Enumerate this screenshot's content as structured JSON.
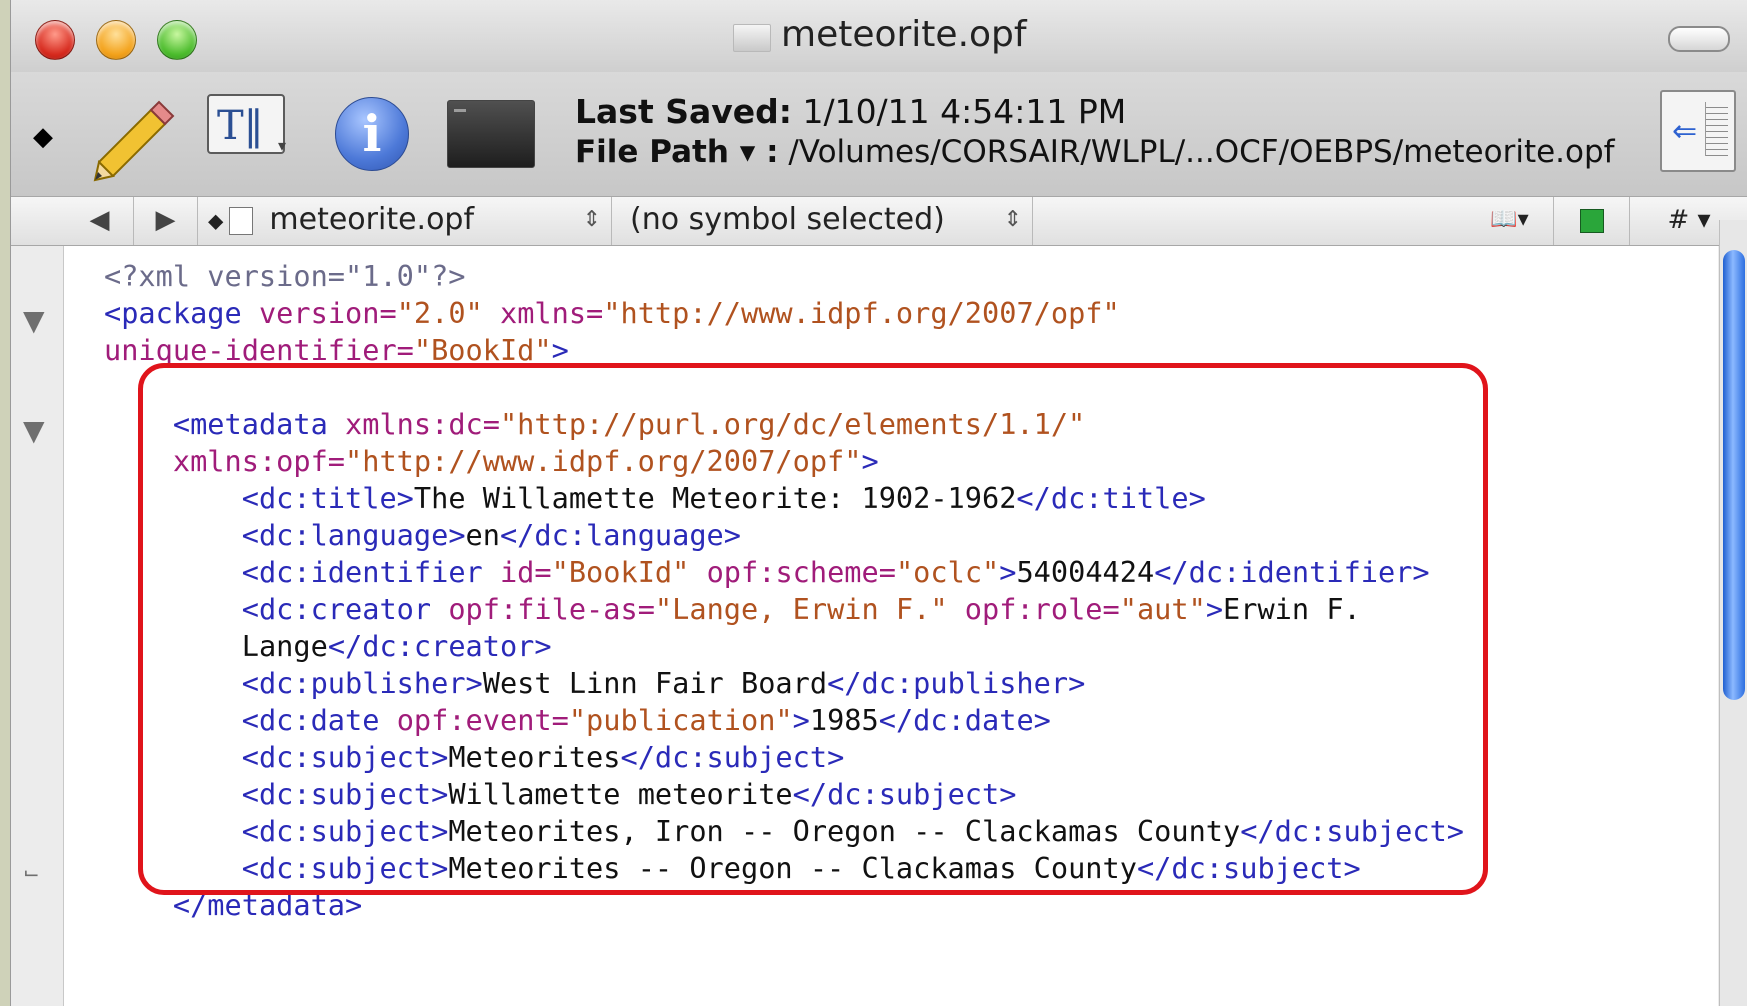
{
  "window": {
    "title": "meteorite.opf"
  },
  "toolbar": {
    "last_saved_label": "Last Saved:",
    "last_saved_value": "1/10/11 4:54:11 PM",
    "file_path_label": "File Path ▾ :",
    "file_path_value": "/Volumes/CORSAIR/WLPL/...OCF/OEBPS/meteorite.opf",
    "icons": [
      "pencil-icon",
      "text-options-icon",
      "info-icon",
      "terminal-icon",
      "side-panel-icon"
    ]
  },
  "navbar": {
    "back": "◀",
    "forward": "▶",
    "file_menu": "meteorite.opf",
    "symbol_menu": "(no symbol selected)",
    "counterpart_icon": "book-icon",
    "green_icon": "green-square-icon",
    "hash_menu": "#"
  },
  "code": {
    "xml_decl": "<?xml version=\"1.0\"?>",
    "package_open_1": "<package",
    "package_attr_version": "version=",
    "package_val_version": "\"2.0\"",
    "package_attr_xmlns": "xmlns=",
    "package_val_xmlns": "\"http://www.idpf.org/2007/opf\"",
    "package_attr_uid": "unique-identifier=",
    "package_val_uid": "\"BookId\"",
    "package_close": ">",
    "metadata_open": "<metadata",
    "metadata_attr_dc": "xmlns:dc=",
    "metadata_val_dc": "\"http://purl.org/dc/elements/1.1/\"",
    "metadata_attr_opf": "xmlns:opf=",
    "metadata_val_opf": "\"http://www.idpf.org/2007/opf\"",
    "gt": ">",
    "title_open": "<dc:title>",
    "title_text": "The Willamette Meteorite: 1902-1962",
    "title_close": "</dc:title>",
    "language_open": "<dc:language>",
    "language_text": "en",
    "language_close": "</dc:language>",
    "identifier_open": "<dc:identifier",
    "identifier_attr_id": "id=",
    "identifier_val_id": "\"BookId\"",
    "identifier_attr_scheme": "opf:scheme=",
    "identifier_val_scheme": "\"oclc\"",
    "identifier_text": "54004424",
    "identifier_close": "</dc:identifier>",
    "creator_open": "<dc:creator",
    "creator_attr_fileas": "opf:file-as=",
    "creator_val_fileas": "\"Lange, Erwin F.\"",
    "creator_attr_role": "opf:role=",
    "creator_val_role": "\"aut\"",
    "creator_text_1": "Erwin F.",
    "creator_text_2": "Lange",
    "creator_close": "</dc:creator>",
    "publisher_open": "<dc:publisher>",
    "publisher_text": "West Linn Fair Board",
    "publisher_close": "</dc:publisher>",
    "date_open": "<dc:date",
    "date_attr_event": "opf:event=",
    "date_val_event": "\"publication\"",
    "date_text": "1985",
    "date_close": "</dc:date>",
    "subject_open": "<dc:subject>",
    "subject_close": "</dc:subject>",
    "subjects": [
      "Meteorites",
      "Willamette meteorite",
      "Meteorites, Iron -- Oregon -- Clackamas County",
      "Meteorites -- Oregon -- Clackamas County"
    ],
    "metadata_close": "</metadata>"
  },
  "colors": {
    "tag": "#2a2ab8",
    "attribute": "#a01c7a",
    "value": "#b0521f",
    "highlight_box": "#e0141b",
    "desktop": "#cfd2b9"
  }
}
